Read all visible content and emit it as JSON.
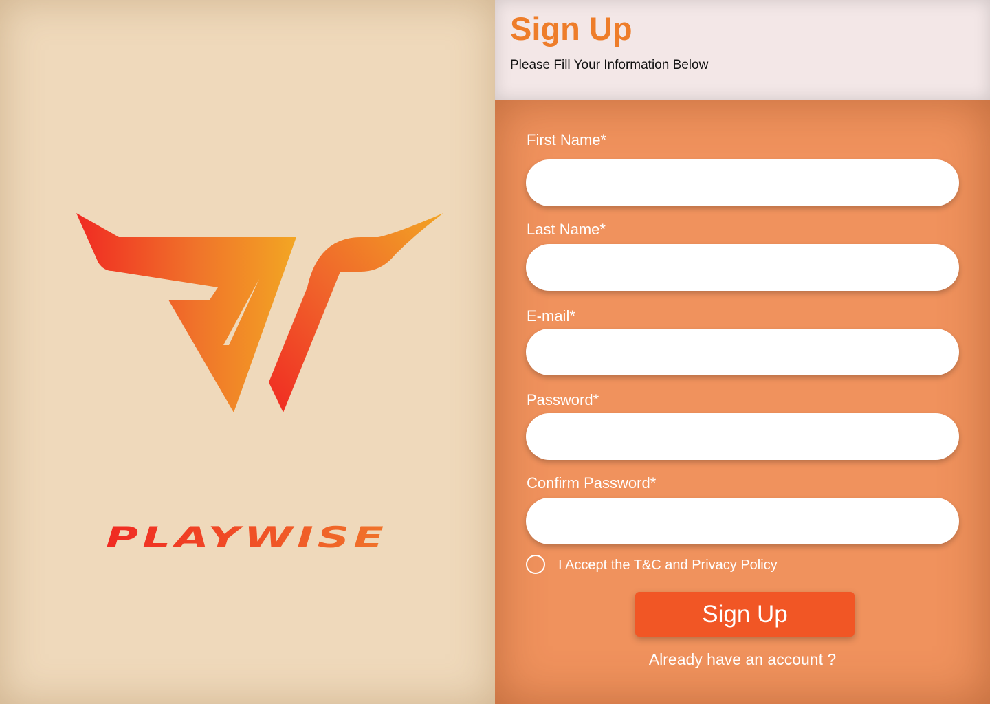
{
  "brand": {
    "name": "PLAYWISE",
    "colors": {
      "gradient_red": "#f02a22",
      "gradient_orange": "#f18a23",
      "gradient_yellow": "#f3a623"
    }
  },
  "header": {
    "title": "Sign Up",
    "subtitle": "Please Fill Your Information Below"
  },
  "form": {
    "fields": [
      {
        "label": "First Name*",
        "value": "",
        "placeholder": ""
      },
      {
        "label": "Last Name*",
        "value": "",
        "placeholder": ""
      },
      {
        "label": "E-mail*",
        "value": "",
        "placeholder": ""
      },
      {
        "label": "Password*",
        "value": "",
        "placeholder": ""
      },
      {
        "label": "Confirm Password*",
        "value": "",
        "placeholder": ""
      }
    ],
    "terms_label": "I Accept the T&C and Privacy Policy",
    "terms_checked": false,
    "submit_label": "Sign Up",
    "login_link": "Already have an account ?"
  },
  "colors": {
    "title_orange": "#ee7d2a",
    "panel_orange": "#f0925d",
    "button_orange": "#f15625",
    "left_bg": "#efd9bb",
    "header_bg": "#f3e7e7"
  }
}
